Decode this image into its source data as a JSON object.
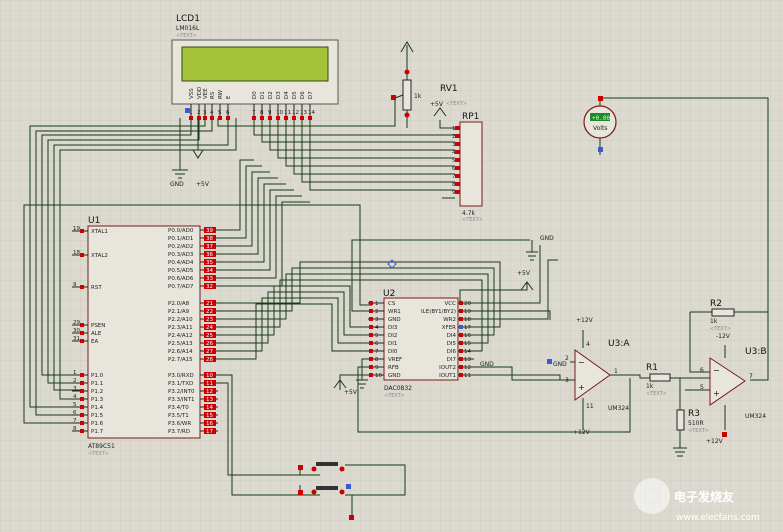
{
  "lcd": {
    "ref": "LCD1",
    "part": "LM016L",
    "text_tag": "<TEXT>",
    "pins": [
      "VSS",
      "VDD",
      "VEE",
      "RS",
      "RW",
      "E",
      "D0",
      "D1",
      "D2",
      "D3",
      "D4",
      "D5",
      "D6",
      "D7"
    ],
    "pin_numbers": [
      "1",
      "2",
      "3",
      "4",
      "5",
      "6",
      "7",
      "8",
      "9",
      "10",
      "11",
      "12",
      "13",
      "14"
    ]
  },
  "rv1": {
    "ref": "RV1",
    "value": "1k",
    "supply": "+5V",
    "text_tag": "<TEXT>"
  },
  "rp1": {
    "ref": "RP1",
    "value": "4.7k",
    "text_tag": "<TEXT>",
    "pins": [
      "1",
      "2",
      "3",
      "4",
      "5",
      "6",
      "7",
      "8",
      "9"
    ]
  },
  "voltmeter": {
    "value": "+0.00",
    "unit": "Volts"
  },
  "power": {
    "gnd": "GND",
    "vcc5": "+5V",
    "vcc12": "+12V",
    "vneg12": "-12V"
  },
  "u1": {
    "ref": "U1",
    "part": "AT89C51",
    "text_tag": "<TEXT>",
    "left_pins": [
      {
        "n": "19",
        "name": "XTAL1"
      },
      {
        "n": "18",
        "name": "XTAL2"
      },
      {
        "n": "9",
        "name": "RST"
      },
      {
        "n": "29",
        "name": "PSEN"
      },
      {
        "n": "30",
        "name": "ALE"
      },
      {
        "n": "31",
        "name": "EA"
      },
      {
        "n": "1",
        "name": "P1.0"
      },
      {
        "n": "2",
        "name": "P1.1"
      },
      {
        "n": "3",
        "name": "P1.2"
      },
      {
        "n": "4",
        "name": "P1.3"
      },
      {
        "n": "5",
        "name": "P1.4"
      },
      {
        "n": "6",
        "name": "P1.5"
      },
      {
        "n": "7",
        "name": "P1.6"
      },
      {
        "n": "8",
        "name": "P1.7"
      }
    ],
    "right_pins": [
      {
        "n": "39",
        "name": "P0.0/AD0"
      },
      {
        "n": "38",
        "name": "P0.1/AD1"
      },
      {
        "n": "37",
        "name": "P0.2/AD2"
      },
      {
        "n": "36",
        "name": "P0.3/AD3"
      },
      {
        "n": "35",
        "name": "P0.4/AD4"
      },
      {
        "n": "34",
        "name": "P0.5/AD5"
      },
      {
        "n": "33",
        "name": "P0.6/AD6"
      },
      {
        "n": "32",
        "name": "P0.7/AD7"
      },
      {
        "n": "21",
        "name": "P2.0/A8"
      },
      {
        "n": "22",
        "name": "P2.1/A9"
      },
      {
        "n": "23",
        "name": "P2.2/A10"
      },
      {
        "n": "24",
        "name": "P2.3/A11"
      },
      {
        "n": "25",
        "name": "P2.4/A12"
      },
      {
        "n": "26",
        "name": "P2.5/A13"
      },
      {
        "n": "27",
        "name": "P2.6/A14"
      },
      {
        "n": "28",
        "name": "P2.7/A15"
      },
      {
        "n": "10",
        "name": "P3.0/RXD"
      },
      {
        "n": "11",
        "name": "P3.1/TXD"
      },
      {
        "n": "12",
        "name": "P3.2/INT0"
      },
      {
        "n": "13",
        "name": "P3.3/INT1"
      },
      {
        "n": "14",
        "name": "P3.4/T0"
      },
      {
        "n": "15",
        "name": "P3.5/T1"
      },
      {
        "n": "16",
        "name": "P3.6/WR"
      },
      {
        "n": "17",
        "name": "P3.7/RD"
      }
    ]
  },
  "u2": {
    "ref": "U2",
    "part": "DAC0832",
    "text_tag": "<TEXT>",
    "left_pins": [
      {
        "n": "1",
        "name": "CS"
      },
      {
        "n": "2",
        "name": "WR1"
      },
      {
        "n": "3",
        "name": "GND"
      },
      {
        "n": "4",
        "name": "DI3"
      },
      {
        "n": "5",
        "name": "DI2"
      },
      {
        "n": "6",
        "name": "DI1"
      },
      {
        "n": "7",
        "name": "DI0"
      },
      {
        "n": "8",
        "name": "VREF"
      },
      {
        "n": "9",
        "name": "RFB"
      },
      {
        "n": "10",
        "name": "GND"
      }
    ],
    "right_pins": [
      {
        "n": "20",
        "name": "VCC"
      },
      {
        "n": "19",
        "name": "ILE(BY1/BY2)"
      },
      {
        "n": "18",
        "name": "WR2"
      },
      {
        "n": "17",
        "name": "XFER"
      },
      {
        "n": "16",
        "name": "DI4"
      },
      {
        "n": "15",
        "name": "DI5"
      },
      {
        "n": "14",
        "name": "DI6"
      },
      {
        "n": "13",
        "name": "DI7"
      },
      {
        "n": "12",
        "name": "IOUT2"
      },
      {
        "n": "11",
        "name": "IOUT1"
      }
    ]
  },
  "u3a": {
    "ref": "U3:A",
    "part": "UM324",
    "pin_in_neg": "2",
    "pin_in_pos": "3",
    "pin_out": "1",
    "supply_pin": "4",
    "gnd_pin": "11"
  },
  "u3b": {
    "ref": "U3:B",
    "part": "UM324",
    "pin_in_neg": "6",
    "pin_in_pos": "5",
    "pin_out": "7"
  },
  "r1": {
    "ref": "R1",
    "value": "1k",
    "text_tag": "<TEXT>"
  },
  "r2": {
    "ref": "R2",
    "value": "1k",
    "text_tag": "<TEXT>"
  },
  "r3": {
    "ref": "R3",
    "value": "510R",
    "text_tag": "<TEXT>"
  },
  "watermark": {
    "title": "电子发烧友",
    "url": "www.elecfans.com"
  }
}
